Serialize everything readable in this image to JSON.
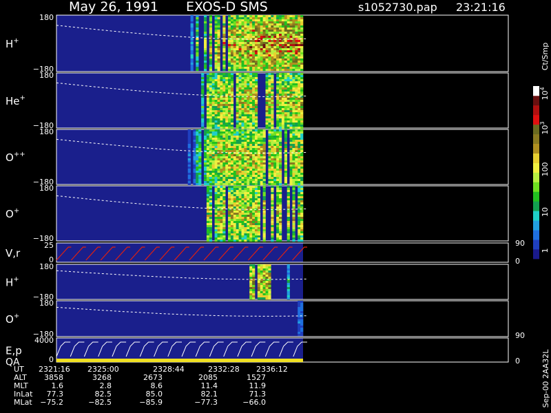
{
  "header": {
    "date": "May 26, 1991",
    "mission": "EXOS-D SMS",
    "file": "s1052730.pap",
    "time": "23:21:16"
  },
  "colorbar": {
    "unit_label": "Ct/Smp",
    "tick_labels": [
      "1",
      "10",
      "100",
      "10",
      "10"
    ],
    "tick_exponents": [
      "",
      "",
      "",
      "3",
      "4"
    ],
    "colors": [
      "#1a1a8c",
      "#1f3fbf",
      "#1f6fdf",
      "#22a0e0",
      "#1fd0c8",
      "#13a050",
      "#22c020",
      "#6fe020",
      "#b8f040",
      "#f0f040",
      "#e8d030",
      "#b09020",
      "#8a7a20",
      "#6a6a20",
      "#e01010",
      "#b01010",
      "#6a1010",
      "#ffffff"
    ]
  },
  "panels": [
    {
      "label": "H",
      "sup": "+",
      "top_tick": "180",
      "bottom_tick": "−180"
    },
    {
      "label": "He",
      "sup": "+",
      "top_tick": "180",
      "bottom_tick": "−180"
    },
    {
      "label": "O",
      "sup": "++",
      "top_tick": "180",
      "bottom_tick": "−180"
    },
    {
      "label": "O",
      "sup": "+",
      "top_tick": "180",
      "bottom_tick": "−180"
    },
    {
      "label": "V,r",
      "sup": "",
      "top_tick": "25",
      "bottom_tick": "0",
      "right_top": "90",
      "right_bottom": "0"
    },
    {
      "label": "H",
      "sup": "+",
      "top_tick": "180",
      "bottom_tick": "−180"
    },
    {
      "label": "O",
      "sup": "+",
      "top_tick": "180",
      "bottom_tick": "−180",
      "right_bottom": "90"
    },
    {
      "label": "E,p",
      "label2": "QA",
      "top_tick": "4000",
      "bottom_tick": "0",
      "right_bottom": "0"
    }
  ],
  "side_note": "Sep-00  2AA32L",
  "ephemeris": {
    "rows": [
      {
        "name": "UT",
        "values": [
          "2321:16",
          "2325:00",
          "2328:44",
          "2332:28",
          "2336:12"
        ]
      },
      {
        "name": "ALT",
        "values": [
          "3858",
          "3268",
          "2673",
          "2085",
          "1527"
        ]
      },
      {
        "name": "MLT",
        "values": [
          "1.6",
          "2.8",
          "8.6",
          "11.4",
          "11.9"
        ]
      },
      {
        "name": "InLat",
        "values": [
          "77.3",
          "82.5",
          "85.0",
          "82.1",
          "71.3"
        ]
      },
      {
        "name": "MLat",
        "values": [
          "−75.2",
          "−82.5",
          "−85.9",
          "−77.3",
          "−66.0"
        ]
      }
    ]
  },
  "chart_data": {
    "type": "heatmap",
    "title": "May 26, 1991   EXOS-D SMS",
    "time_ticks": [
      "2321:16",
      "2325:00",
      "2328:44",
      "2332:28",
      "2336:12"
    ],
    "colorbar_range": [
      1,
      10000
    ],
    "colorbar_scale": "log",
    "panels": [
      {
        "name": "H+",
        "ylim": [
          -180,
          180
        ],
        "activity": [
          0,
          0,
          0,
          0,
          0,
          0,
          0,
          0,
          0,
          0,
          0,
          0,
          0.3,
          0.6,
          0.8,
          0.9,
          0.9,
          0.9,
          1,
          1,
          1,
          1,
          1
        ]
      },
      {
        "name": "He+",
        "ylim": [
          -180,
          180
        ],
        "activity": [
          0,
          0,
          0,
          0,
          0,
          0,
          0,
          0,
          0,
          0,
          0,
          0,
          0.2,
          0.5,
          0.7,
          0.8,
          0.8,
          0.8,
          0.8,
          0.8,
          0.8,
          0.8,
          0.8
        ]
      },
      {
        "name": "O++",
        "ylim": [
          -180,
          180
        ],
        "activity": [
          0,
          0,
          0,
          0,
          0,
          0,
          0,
          0,
          0,
          0,
          0,
          0,
          0.2,
          0.5,
          0.7,
          0.8,
          0.8,
          0.8,
          0.8,
          0.8,
          0.8,
          0.8,
          0.8
        ]
      },
      {
        "name": "O+",
        "ylim": [
          -180,
          180
        ],
        "activity": [
          0,
          0,
          0,
          0,
          0,
          0,
          0,
          0,
          0,
          0,
          0,
          0,
          0.2,
          0.5,
          0.7,
          0.8,
          0.8,
          0.8,
          0.8,
          0.8,
          0.8,
          0.8,
          0.8
        ]
      },
      {
        "name": "H+ (lower)",
        "ylim": [
          -180,
          180
        ],
        "activity": [
          0,
          0,
          0,
          0,
          0,
          0,
          0,
          0,
          0,
          0,
          0,
          0,
          0,
          0,
          0,
          0,
          0,
          0,
          0.9,
          0.9,
          0,
          0.4,
          0
        ]
      },
      {
        "name": "O+ (lower)",
        "ylim": [
          -180,
          180
        ],
        "activity": [
          0,
          0,
          0,
          0,
          0,
          0,
          0,
          0,
          0,
          0,
          0,
          0,
          0,
          0,
          0,
          0,
          0,
          0,
          0,
          0,
          0,
          0,
          0.2
        ]
      }
    ]
  }
}
